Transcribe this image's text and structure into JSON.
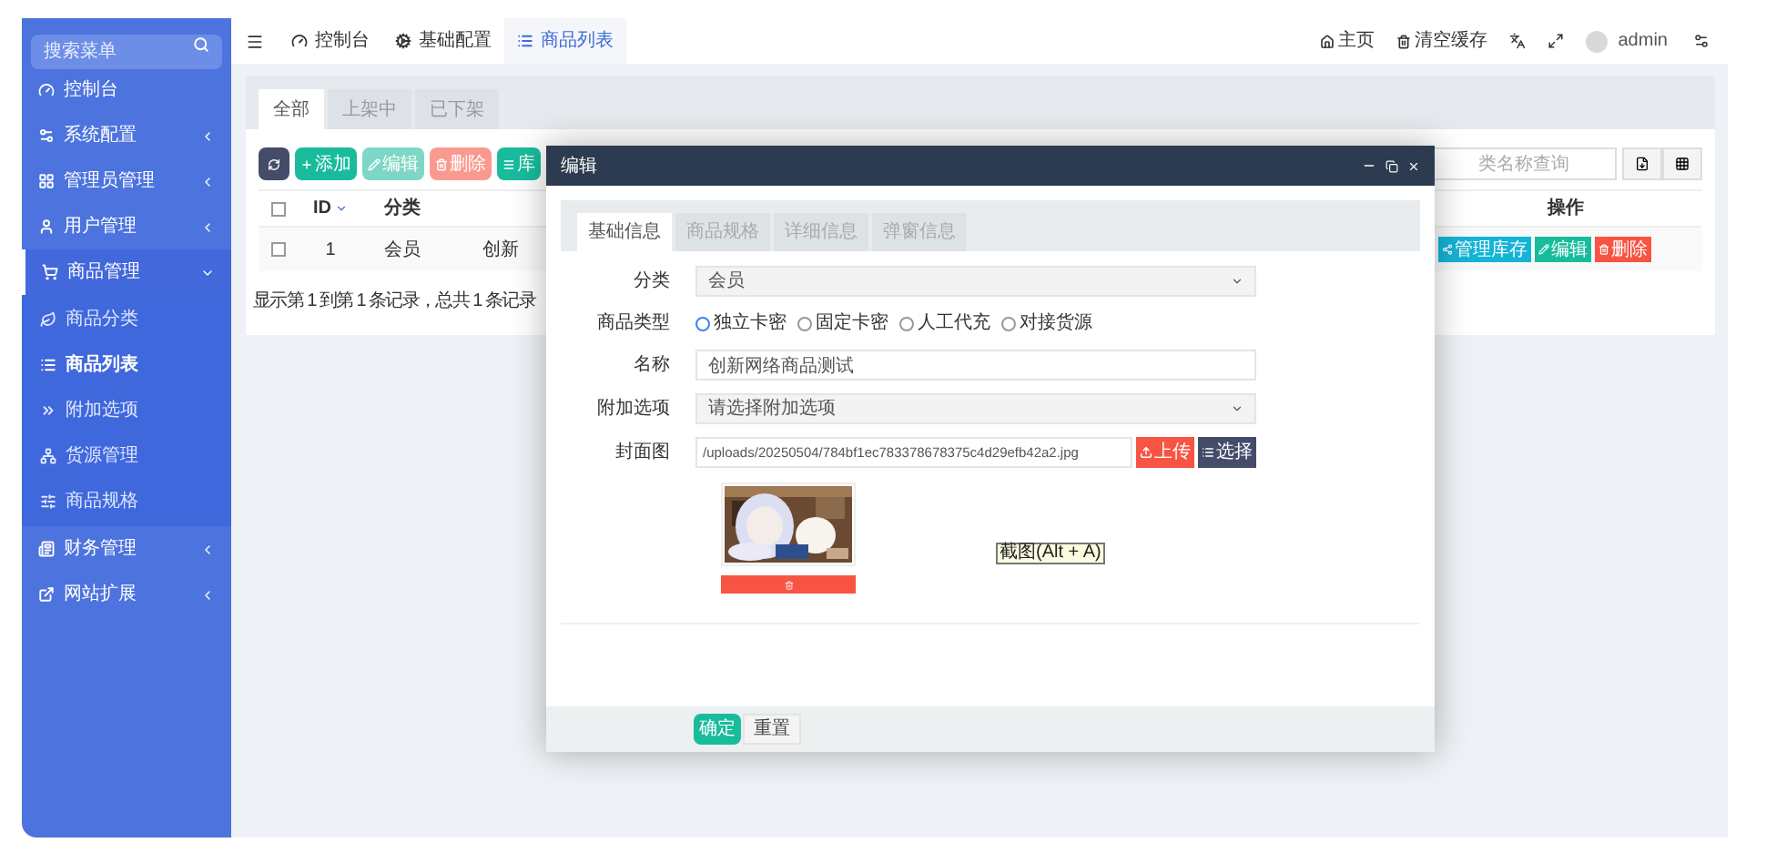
{
  "sidebar": {
    "search": {
      "placeholder": "搜索菜单"
    },
    "items": [
      {
        "label": "控制台",
        "selected": false
      },
      {
        "label": "系统配置",
        "selected": false,
        "expanded": false
      },
      {
        "label": "管理员管理",
        "selected": false,
        "expanded": false
      },
      {
        "label": "用户管理",
        "selected": false,
        "expanded": false
      },
      {
        "label": "商品管理",
        "selected": false,
        "expanded": true,
        "children": [
          {
            "label": "商品分类",
            "selected": false
          },
          {
            "label": "商品列表",
            "selected": true
          },
          {
            "label": "附加选项",
            "selected": false
          },
          {
            "label": "货源管理",
            "selected": false
          },
          {
            "label": "商品规格",
            "selected": false
          }
        ]
      },
      {
        "label": "财务管理",
        "selected": false,
        "expanded": false
      },
      {
        "label": "网站扩展",
        "selected": false,
        "expanded": false
      }
    ]
  },
  "top_tabs": [
    {
      "label": "控制台",
      "selected": false
    },
    {
      "label": "基础配置",
      "selected": false
    },
    {
      "label": "商品列表",
      "selected": true
    }
  ],
  "top_right": {
    "home": "主页",
    "clear_cache": "清空缓存",
    "user": "admin"
  },
  "page_tabs": [
    {
      "label": "全部",
      "selected": true
    },
    {
      "label": "上架中",
      "selected": false
    },
    {
      "label": "已下架",
      "selected": false
    }
  ],
  "toolbar": [
    {
      "kind": "refresh",
      "disabled": false
    },
    {
      "kind": "add",
      "label": "添加",
      "disabled": false
    },
    {
      "kind": "edit",
      "label": "编辑",
      "disabled": true
    },
    {
      "kind": "delete",
      "label": "删除",
      "disabled": true
    },
    {
      "kind": "more",
      "label": "库",
      "disabled": false
    }
  ],
  "search": {
    "placeholder": "类名称查询"
  },
  "table": {
    "select_all": {
      "checked": false
    },
    "columns": [
      "ID",
      "分类",
      "操作"
    ],
    "rows": [
      {
        "checked": false,
        "id": "1",
        "category": "会员",
        "name": "创新",
        "actions": [
          "管理库存",
          "编辑",
          "删除"
        ]
      }
    ]
  },
  "footer": "显示第 1 到第 1 条记录，总共 1 条记录",
  "modal": {
    "title": "编辑",
    "tabs": [
      {
        "label": "基础信息",
        "selected": true
      },
      {
        "label": "商品规格",
        "selected": false
      },
      {
        "label": "详细信息",
        "selected": false
      },
      {
        "label": "弹窗信息",
        "selected": false
      }
    ],
    "fields": [
      {
        "kind": "select",
        "label": "分类",
        "value": "会员"
      },
      {
        "kind": "radio",
        "label": "商品类型",
        "options": [
          {
            "label": "独立卡密",
            "selected": true
          },
          {
            "label": "固定卡密",
            "selected": false
          },
          {
            "label": "人工代充",
            "selected": false
          },
          {
            "label": "对接货源",
            "selected": false
          }
        ]
      },
      {
        "kind": "text",
        "label": "名称",
        "value": "创新网络商品测试"
      },
      {
        "kind": "select",
        "label": "附加选项",
        "placeholder": "请选择附加选项"
      },
      {
        "kind": "file",
        "label": "封面图",
        "value": "/uploads/20250504/784bf1ec783378678375c4d29efb42a2.jpg",
        "buttons": [
          "上传",
          "选择"
        ]
      }
    ],
    "buttons": [
      "确定",
      "重置"
    ]
  },
  "tooltip": "截图(Alt + A)"
}
